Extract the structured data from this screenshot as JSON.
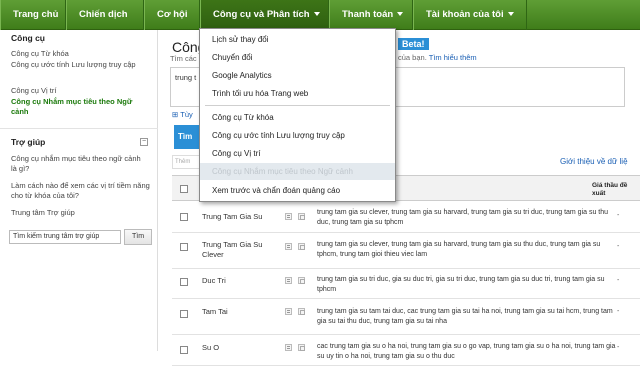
{
  "nav": {
    "items": [
      {
        "label": "Trang chủ"
      },
      {
        "label": "Chiến dịch"
      },
      {
        "label": "Cơ hội"
      },
      {
        "label": "Công cụ và Phân tích"
      },
      {
        "label": "Thanh toán"
      },
      {
        "label": "Tài khoản của tôi"
      }
    ]
  },
  "sidebar": {
    "tools_heading": "Công cụ",
    "tools": [
      {
        "label": "Công cụ Từ khóa"
      },
      {
        "label": "Công cụ ước tính Lưu lượng truy cập"
      },
      {
        "label": "Công cụ Vị trí"
      },
      {
        "label": "Công cụ Nhắm mục tiêu theo Ngữ cảnh"
      }
    ],
    "help_heading": "Trợ giúp",
    "help_links": [
      {
        "label": "Công cụ nhắm mục tiêu theo ngữ cảnh là gì?"
      },
      {
        "label": "Làm cách nào để xem các vị trí tiềm năng cho từ khóa của tôi?"
      },
      {
        "label": "Trung tâm Trợ giúp"
      }
    ],
    "search_value": "Tìm kiếm trung tâm trợ giúp",
    "search_button": "Tìm"
  },
  "main": {
    "title": "Công",
    "subtitle": "Tìm các",
    "beta": "Beta!",
    "sub_right_prefix": "của bạn.",
    "learn_more": "Tìm hiểu thêm",
    "query_text": "trung t",
    "tuy_chon": "Tùy",
    "search_button": "Tìm",
    "filter_placeholder": "Thêm",
    "intro_link": "Giới thiệu về dữ liệ",
    "col_bid": "Giá thầu đề xuất",
    "rows": [
      {
        "keyword": "Trung Tam Gia Su",
        "desc": "trung tam gia su clever, trung tam gia su harvard, trung tam gia su tri duc, trung tam gia su thu duc, trung tam gia su tphcm",
        "bid": "-"
      },
      {
        "keyword": "Trung Tam Gia Su Clever",
        "desc": "trung tam gia su clever, trung tam gia su harvard, trung tam gia su thu duc, trung tam gia su tphcm, trung tam gioi thieu viec lam",
        "bid": "-"
      },
      {
        "keyword": "Duc Tri",
        "desc": "trung tam gia su tri duc, gia su duc tri, gia su tri duc, trung tam gia su duc tri, trung tam gia su tphcm",
        "bid": "-"
      },
      {
        "keyword": "Tam Tai",
        "desc": "trung tam gia su tam tai duc, cac trung tam gia su tai ha noi, trung tam gia su tai hcm, trung tam gia su tai thu duc, trung tam gia su tai nha",
        "bid": "-"
      },
      {
        "keyword": "Su O",
        "desc": "cac trung tam gia su o ha noi, trung tam gia su o go vap, trung tam gia su o ha noi, trung tam gia su uy tin o ha noi, trung tam gia su o thu duc",
        "bid": "-"
      }
    ]
  },
  "dropdown": {
    "items": [
      {
        "label": "Lịch sử thay đổi"
      },
      {
        "label": "Chuyển đổi"
      },
      {
        "label": "Google Analytics"
      },
      {
        "label": "Trình tối ưu hóa Trang web"
      },
      {
        "label": "Công cụ Từ khóa"
      },
      {
        "label": "Công cụ ước tính Lưu lượng truy cập"
      },
      {
        "label": "Công cụ Vị trí"
      },
      {
        "label": "Công cụ Nhắm mục tiêu theo Ngữ cảnh"
      },
      {
        "label": "Xem trước và chẩn đoán quảng cáo"
      }
    ]
  }
}
